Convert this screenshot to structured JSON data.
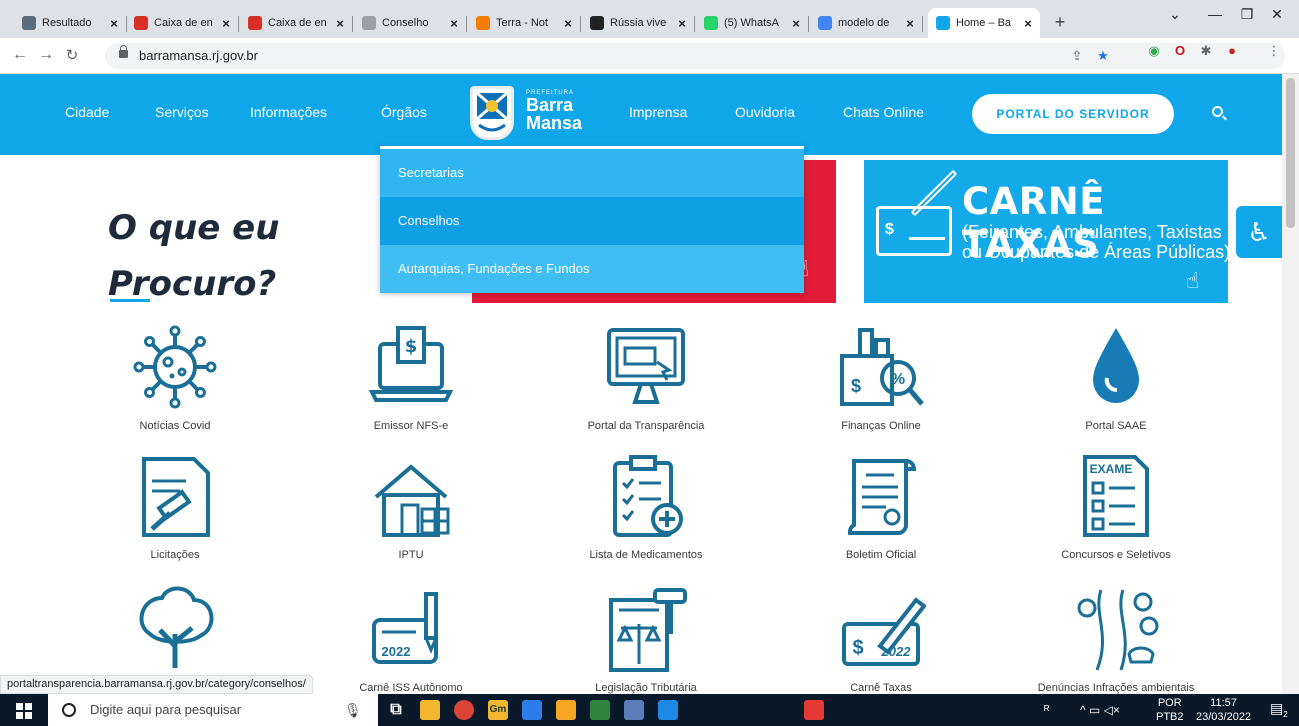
{
  "browser": {
    "tabs": [
      {
        "title": "Resultado",
        "icon": "image-favicon",
        "color": "#5a6b7c"
      },
      {
        "title": "Caixa de en",
        "icon": "gmail-favicon",
        "color": "#d93025"
      },
      {
        "title": "Caixa de en",
        "icon": "gmail-favicon",
        "color": "#d93025"
      },
      {
        "title": "Conselho",
        "icon": "page-favicon",
        "color": "#9aa0a6"
      },
      {
        "title": "Terra - Not",
        "icon": "terra-favicon",
        "color": "#f57c00"
      },
      {
        "title": "Rússia vive",
        "icon": "news-favicon",
        "color": "#222222"
      },
      {
        "title": "(5) WhatsA",
        "icon": "whatsapp-favicon",
        "color": "#25d366"
      },
      {
        "title": "modelo de",
        "icon": "google-favicon",
        "color": "#4285f4"
      },
      {
        "title": "Home – Ba",
        "icon": "barramansa-favicon",
        "color": "#0fa6ea"
      }
    ],
    "url": "barramansa.rj.gov.br"
  },
  "site": {
    "nav_left": [
      "Cidade",
      "Serviços",
      "Informações",
      "Órgãos"
    ],
    "nav_right": [
      "Imprensa",
      "Ouvidoria",
      "Chats Online"
    ],
    "logo": {
      "prefeitura": "PREFEITURA",
      "line1": "Barra",
      "line2": "Mansa"
    },
    "portal_button": "PORTAL DO SERVIDOR",
    "dropdown": [
      "Secretarias",
      "Conselhos",
      "Autarquias, Fundações e Fundos"
    ],
    "heading_line1": "O que eu",
    "heading_line2": "Procuro?",
    "banner": {
      "title": "CARNÊ TAXAS",
      "subtitle": "(Feirantes, Ambulantes, Taxistas ou Ocupantes de Áreas Públicas)",
      "symbol": "$"
    },
    "services": [
      "Notícias Covid",
      "Emissor NFS-e",
      "Portal da Transparência",
      "Finanças Online",
      "Portal SAAE",
      "Licitações",
      "IPTU",
      "Lista de Medicamentos",
      "Boletim Oficial",
      "Concursos e Seletivos",
      "",
      "Carnê ISS Autônomo",
      "Legislação Tributária",
      "Carnê Taxas",
      "Denúncias Infrações ambientais"
    ],
    "icon_texts": {
      "exame": "EXAME",
      "year": "2022"
    },
    "accent": "#0fa6ea"
  },
  "status_url": "portaltransparencia.barramansa.rj.gov.br/category/conselhos/",
  "taskbar": {
    "search_placeholder": "Digite aqui para pesquisar",
    "lang": "POR",
    "layout": "PTB2",
    "time": "11:57",
    "date": "23/03/2022",
    "notifications": "2"
  }
}
